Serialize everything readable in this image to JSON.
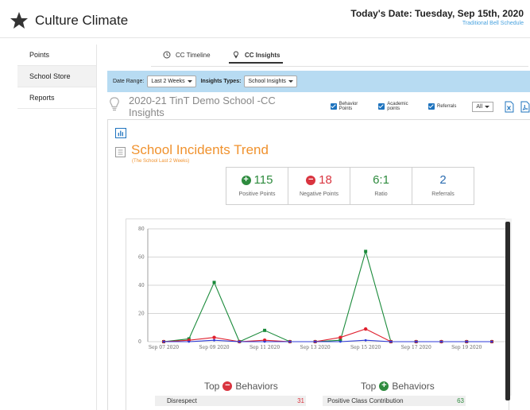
{
  "app": {
    "title": "Culture Climate"
  },
  "header": {
    "date_text": "Today's Date: Tuesday, Sep 15th, 2020",
    "schedule": "Traditional Bell Schedule"
  },
  "sidebar": {
    "items": [
      {
        "label": "Points"
      },
      {
        "label": "School Store"
      },
      {
        "label": "Reports"
      }
    ]
  },
  "tabs": [
    {
      "label": "CC Timeline"
    },
    {
      "label": "CC Insights"
    }
  ],
  "filters": {
    "date_range_label": "Date Range:",
    "date_range_value": "Last 2 Weeks",
    "insight_types_label": "Insights Types:",
    "insight_types_value": "School Insights"
  },
  "school": {
    "title": "2020-21 TinT Demo School -CC Insights",
    "checkboxes": [
      {
        "label": "Behavior Points"
      },
      {
        "label": "Academic points"
      },
      {
        "label": "Referrals"
      }
    ],
    "all_value": "All"
  },
  "trend": {
    "title": "School Incidents Trend",
    "subtitle": "(The School Last 2 Weeks)"
  },
  "stats": [
    {
      "value": "115",
      "label": "Positive Points",
      "color": "#2e8b3e"
    },
    {
      "value": "18",
      "label": "Negative Points",
      "color": "#d9343f"
    },
    {
      "value": "6:1",
      "label": "Ratio",
      "color": "#2e8b3e"
    },
    {
      "value": "2",
      "label": "Referrals",
      "color": "#2b6cb0"
    }
  ],
  "chart_data": {
    "type": "line",
    "x": [
      "Sep 07 2020",
      "Sep 08 2020",
      "Sep 09 2020",
      "Sep 10 2020",
      "Sep 11 2020",
      "Sep 12 2020",
      "Sep 13 2020",
      "Sep 14 2020",
      "Sep 15 2020",
      "Sep 16 2020",
      "Sep 17 2020",
      "Sep 18 2020",
      "Sep 19 2020",
      "Sep 20 2020"
    ],
    "xticks": [
      "Sep 07 2020",
      "Sep 09 2020",
      "Sep 11 2020",
      "Sep 13 2020",
      "Sep 15 2020",
      "Sep 17 2020",
      "Sep 19 2020"
    ],
    "ylim": [
      0,
      80
    ],
    "yticks": [
      0,
      20,
      40,
      60,
      80
    ],
    "grid": true,
    "series": [
      {
        "color": "#1a8a3a",
        "values": [
          0,
          2,
          42,
          0,
          8,
          0,
          0,
          1,
          64,
          0,
          0,
          0,
          0,
          0
        ]
      },
      {
        "color": "#e0202e",
        "values": [
          0,
          1,
          3,
          0,
          1,
          0,
          0,
          3,
          9,
          0,
          0,
          0,
          0,
          0
        ]
      },
      {
        "color": "#2d3bd8",
        "values": [
          0,
          0,
          1,
          0,
          0,
          0,
          0,
          0,
          1,
          0,
          0,
          0,
          0,
          0
        ]
      }
    ]
  },
  "top_negative": {
    "label": "Top",
    "label2": "Behaviors",
    "rows": [
      {
        "name": "Disrespect",
        "count": "31"
      }
    ]
  },
  "top_positive": {
    "label": "Top",
    "label2": "Behaviors",
    "rows": [
      {
        "name": "Positive Class Contribution",
        "count": "63"
      }
    ]
  }
}
